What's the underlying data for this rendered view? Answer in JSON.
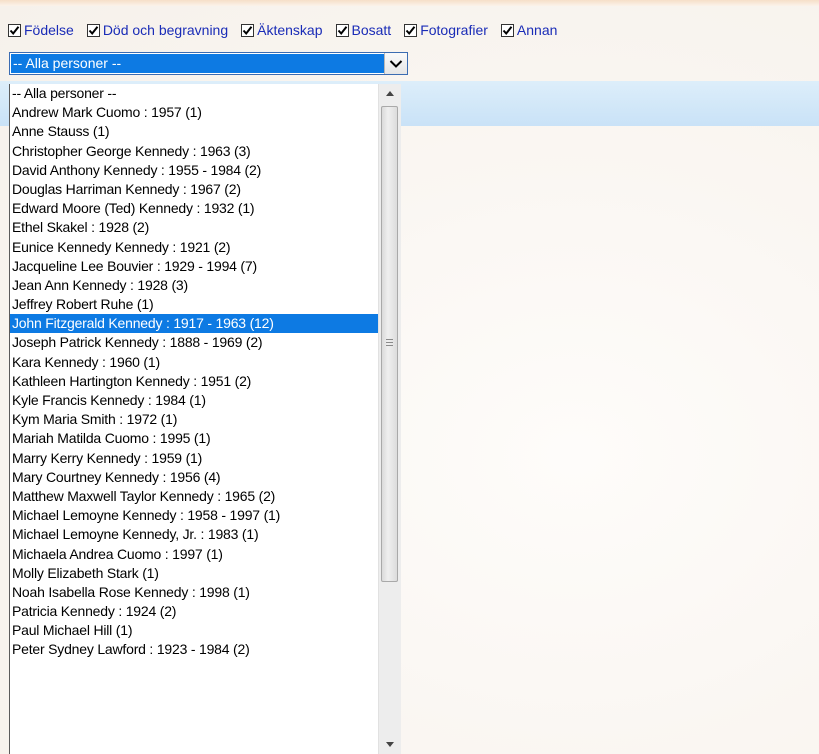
{
  "filters": [
    {
      "label": "Födelse",
      "checked": true
    },
    {
      "label": "Död och begravning",
      "checked": true
    },
    {
      "label": "Äktenskap",
      "checked": true
    },
    {
      "label": "Bosatt",
      "checked": true
    },
    {
      "label": "Fotografier",
      "checked": true
    },
    {
      "label": "Annan",
      "checked": true
    }
  ],
  "person_select": {
    "value": "-- Alla personer --",
    "selected_item": "John Fitzgerald Kennedy : 1917 - 1963 (12)"
  },
  "person_list": [
    "-- Alla personer --",
    "Andrew Mark Cuomo : 1957 (1)",
    "Anne Stauss (1)",
    "Christopher George Kennedy : 1963 (3)",
    "David Anthony Kennedy : 1955 - 1984 (2)",
    "Douglas Harriman Kennedy : 1967 (2)",
    "Edward Moore (Ted) Kennedy : 1932 (1)",
    "Ethel Skakel : 1928 (2)",
    "Eunice Kennedy Kennedy : 1921 (2)",
    "Jacqueline Lee Bouvier : 1929 - 1994 (7)",
    "Jean Ann Kennedy : 1928 (3)",
    "Jeffrey Robert Ruhe (1)",
    "John Fitzgerald Kennedy : 1917 - 1963 (12)",
    "Joseph Patrick Kennedy : 1888 - 1969 (2)",
    "Kara Kennedy : 1960 (1)",
    "Kathleen Hartington Kennedy : 1951 (2)",
    "Kyle Francis Kennedy : 1984 (1)",
    "Kym Maria Smith : 1972 (1)",
    "Mariah Matilda Cuomo : 1995 (1)",
    "Marry Kerry Kennedy : 1959 (1)",
    "Mary Courtney Kennedy : 1956 (4)",
    "Matthew Maxwell Taylor Kennedy : 1965 (2)",
    "Michael Lemoyne Kennedy : 1958 - 1997 (1)",
    "Michael Lemoyne Kennedy, Jr. : 1983 (1)",
    "Michaela Andrea Cuomo : 1997 (1)",
    "Molly Elizabeth Stark (1)",
    "Noah Isabella Rose Kennedy : 1998 (1)",
    "Patricia Kennedy : 1924 (2)",
    "Paul Michael Hill (1)",
    "Peter Sydney Lawford : 1923 - 1984 (2)"
  ],
  "colors": {
    "filter_label": "#1a2cb7",
    "selection_bg": "#0d7ae3",
    "band": "#d3e8f8"
  },
  "icons": {
    "checkbox": "checkmark-icon",
    "select_button": "chevron-down-icon",
    "scroll_up": "arrow-up-icon",
    "scroll_down": "arrow-down-icon"
  }
}
